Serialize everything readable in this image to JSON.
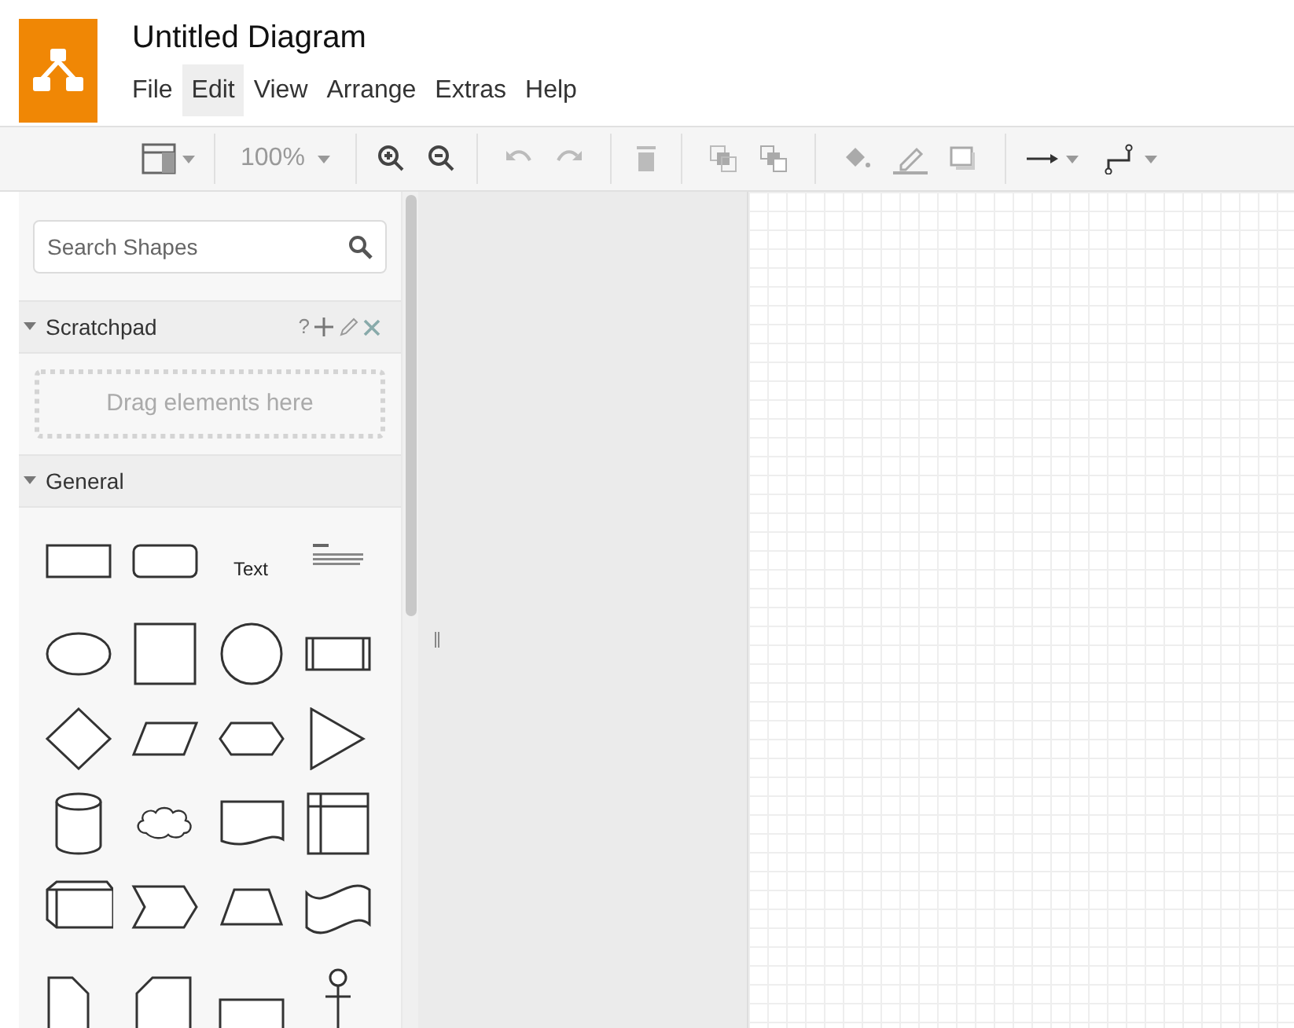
{
  "window": {
    "title": "Untitled Diagram"
  },
  "menu": [
    {
      "label": "File",
      "selected": false
    },
    {
      "label": "Edit",
      "selected": true
    },
    {
      "label": "View",
      "selected": false
    },
    {
      "label": "Arrange",
      "selected": false
    },
    {
      "label": "Extras",
      "selected": false
    },
    {
      "label": "Help",
      "selected": false
    }
  ],
  "toolbar": {
    "zoom": "100%"
  },
  "sidebar": {
    "search": {
      "placeholder": "Search Shapes"
    },
    "sections": [
      {
        "title": "Scratchpad",
        "expanded": true,
        "kind": "scratchpad",
        "actions": [
          "?"
        ],
        "drop_hint": "Drag elements here"
      },
      {
        "title": "General",
        "expanded": true,
        "kind": "shapes",
        "text_shape": "Text"
      }
    ]
  }
}
